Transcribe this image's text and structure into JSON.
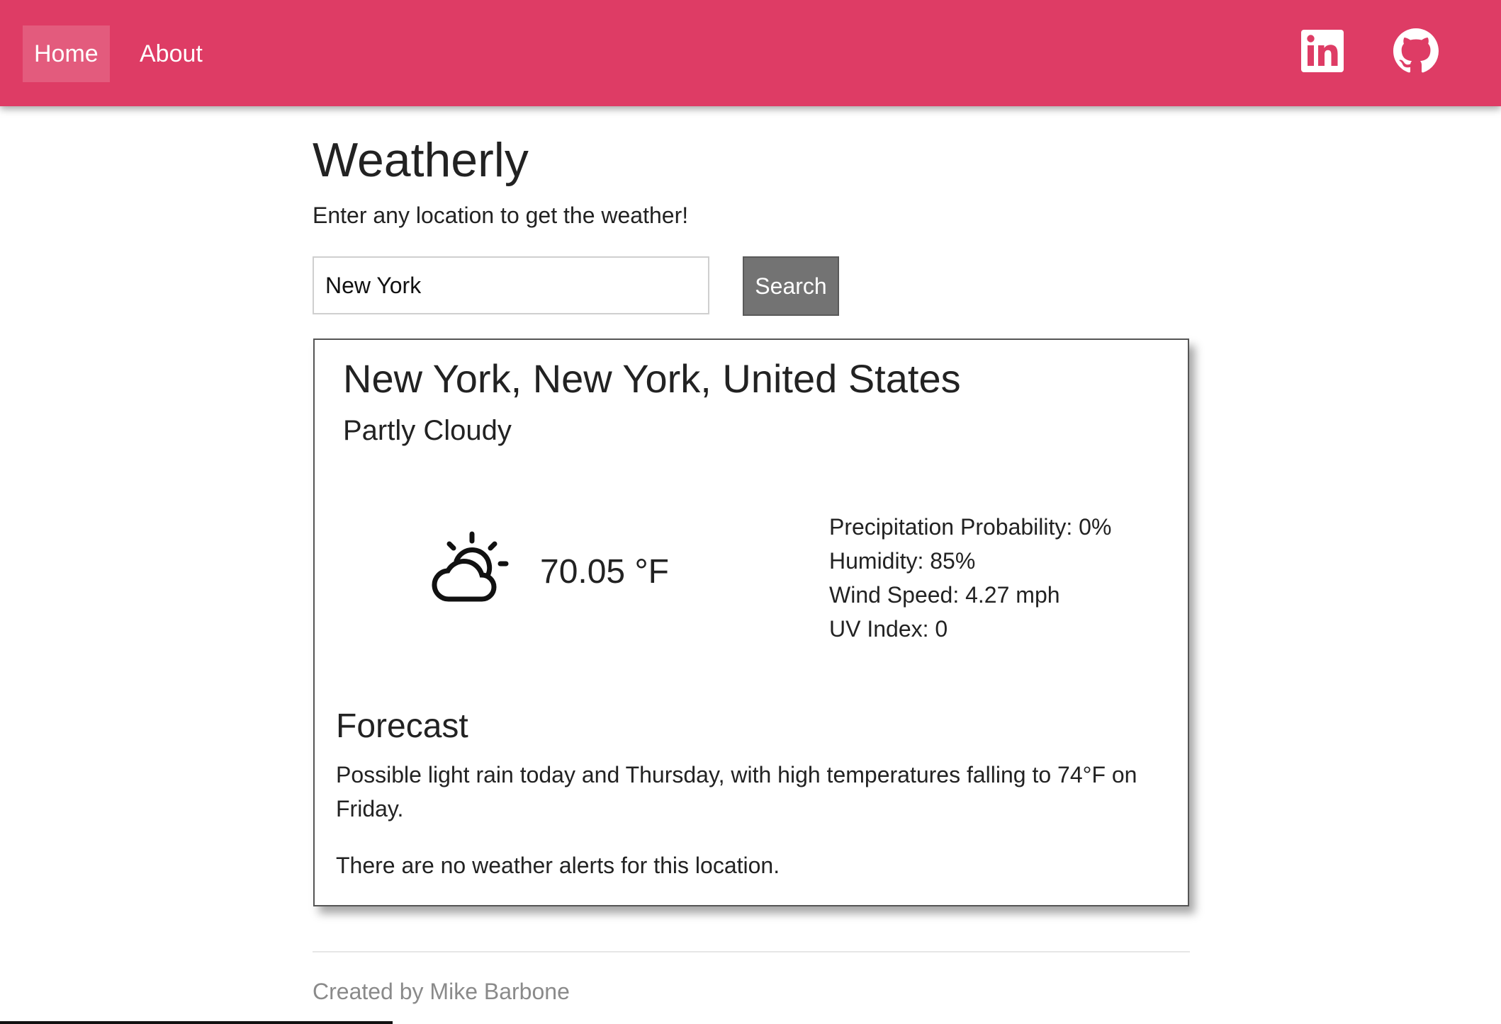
{
  "nav": {
    "home_label": "Home",
    "about_label": "About",
    "social_icons": [
      "linkedin-icon",
      "github-icon"
    ]
  },
  "colors": {
    "navbar": "#de3c65",
    "search_button": "#737373",
    "footer_text": "#8a8a8a"
  },
  "header": {
    "title": "Weatherly",
    "subtitle": "Enter any location to get the weather!"
  },
  "search": {
    "value": "New York",
    "placeholder": "",
    "button_label": "Search"
  },
  "weather": {
    "location": "New York, New York, United States",
    "condition": "Partly Cloudy",
    "icon": "partly-cloudy-icon",
    "temperature": "70.05 °F",
    "stats": {
      "precipitation": "Precipitation Probability: 0%",
      "humidity": "Humidity: 85%",
      "wind": "Wind Speed: 4.27 mph",
      "uv": "UV Index: 0"
    }
  },
  "forecast": {
    "heading": "Forecast",
    "summary": "Possible light rain today and Thursday, with high temperatures falling to 74°F on Friday.",
    "alerts": "There are no weather alerts for this location."
  },
  "footer": {
    "credit": "Created by Mike Barbone"
  }
}
